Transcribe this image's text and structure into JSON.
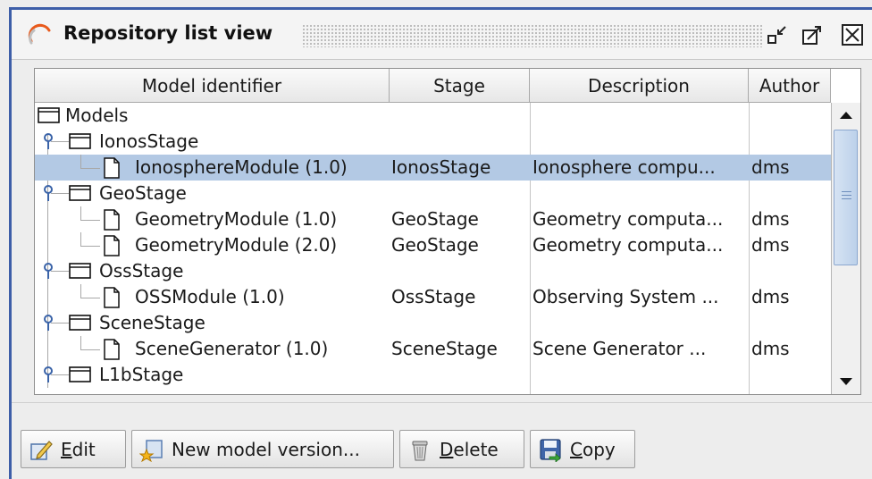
{
  "window": {
    "title": "Repository list view",
    "icons": {
      "app": "refresh-arc-icon",
      "minimize": "minimize-arrow-icon",
      "maximize": "maximize-arrow-icon",
      "close": "close-x-icon"
    }
  },
  "table": {
    "columns": [
      "Model identifier",
      "Stage",
      "Description",
      "Author"
    ],
    "rows": [
      {
        "level": 0,
        "type": "folder",
        "name": "Models",
        "stage": "",
        "description": "",
        "author": ""
      },
      {
        "level": 1,
        "type": "folder",
        "name": "IonosStage",
        "stage": "",
        "description": "",
        "author": ""
      },
      {
        "level": 2,
        "type": "file",
        "name": "IonosphereModule (1.0)",
        "stage": "IonosStage",
        "description": "Ionosphere compu...",
        "author": "dms",
        "selected": true
      },
      {
        "level": 1,
        "type": "folder",
        "name": "GeoStage",
        "stage": "",
        "description": "",
        "author": ""
      },
      {
        "level": 2,
        "type": "file",
        "name": "GeometryModule (1.0)",
        "stage": "GeoStage",
        "description": "Geometry computa...",
        "author": "dms"
      },
      {
        "level": 2,
        "type": "file",
        "name": "GeometryModule (2.0)",
        "stage": "GeoStage",
        "description": "Geometry computa...",
        "author": "dms"
      },
      {
        "level": 1,
        "type": "folder",
        "name": "OssStage",
        "stage": "",
        "description": "",
        "author": ""
      },
      {
        "level": 2,
        "type": "file",
        "name": "OSSModule (1.0)",
        "stage": "OssStage",
        "description": "Observing System ...",
        "author": "dms"
      },
      {
        "level": 1,
        "type": "folder",
        "name": "SceneStage",
        "stage": "",
        "description": "",
        "author": ""
      },
      {
        "level": 2,
        "type": "file",
        "name": "SceneGenerator (1.0)",
        "stage": "SceneStage",
        "description": "Scene Generator ...",
        "author": "dms"
      },
      {
        "level": 1,
        "type": "folder",
        "name": "L1bStage",
        "stage": "",
        "description": "",
        "author": ""
      }
    ]
  },
  "toolbar": {
    "edit": {
      "mnemonic": "E",
      "rest": "dit",
      "icon": "edit-pencil-icon"
    },
    "new_version": {
      "label": "New model version...",
      "icon": "new-star-icon"
    },
    "delete": {
      "mnemonic": "D",
      "rest": "elete",
      "icon": "trash-can-icon"
    },
    "copy": {
      "mnemonic": "C",
      "rest": "opy",
      "icon": "floppy-disk-icon"
    }
  },
  "colors": {
    "selection": "#b3c9e4",
    "frame_accent": "#3d5ea8",
    "tree_expander": "#3a63a8"
  }
}
